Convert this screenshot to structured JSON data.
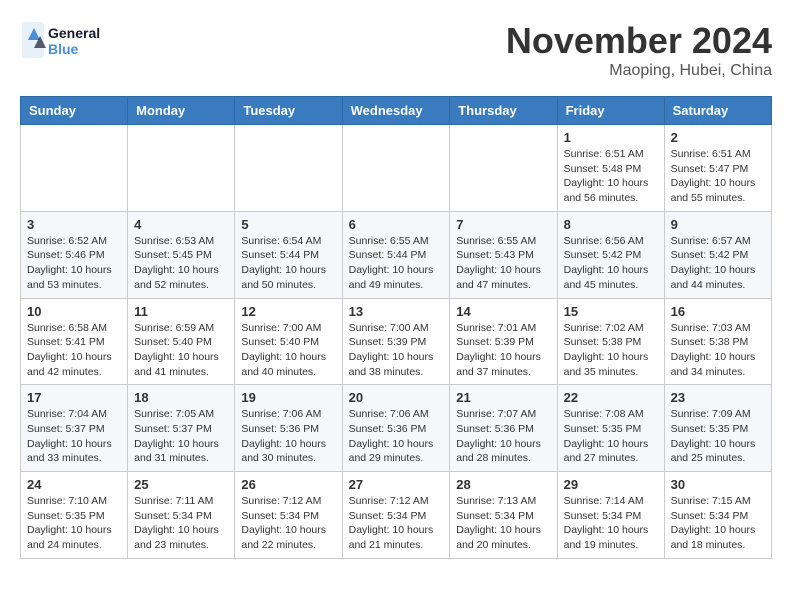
{
  "logo": {
    "line1": "General",
    "line2": "Blue"
  },
  "title": "November 2024",
  "location": "Maoping, Hubei, China",
  "days_of_week": [
    "Sunday",
    "Monday",
    "Tuesday",
    "Wednesday",
    "Thursday",
    "Friday",
    "Saturday"
  ],
  "weeks": [
    [
      null,
      null,
      null,
      null,
      null,
      {
        "day": "1",
        "sunrise": "Sunrise: 6:51 AM",
        "sunset": "Sunset: 5:48 PM",
        "daylight": "Daylight: 10 hours and 56 minutes."
      },
      {
        "day": "2",
        "sunrise": "Sunrise: 6:51 AM",
        "sunset": "Sunset: 5:47 PM",
        "daylight": "Daylight: 10 hours and 55 minutes."
      }
    ],
    [
      {
        "day": "3",
        "sunrise": "Sunrise: 6:52 AM",
        "sunset": "Sunset: 5:46 PM",
        "daylight": "Daylight: 10 hours and 53 minutes."
      },
      {
        "day": "4",
        "sunrise": "Sunrise: 6:53 AM",
        "sunset": "Sunset: 5:45 PM",
        "daylight": "Daylight: 10 hours and 52 minutes."
      },
      {
        "day": "5",
        "sunrise": "Sunrise: 6:54 AM",
        "sunset": "Sunset: 5:44 PM",
        "daylight": "Daylight: 10 hours and 50 minutes."
      },
      {
        "day": "6",
        "sunrise": "Sunrise: 6:55 AM",
        "sunset": "Sunset: 5:44 PM",
        "daylight": "Daylight: 10 hours and 49 minutes."
      },
      {
        "day": "7",
        "sunrise": "Sunrise: 6:55 AM",
        "sunset": "Sunset: 5:43 PM",
        "daylight": "Daylight: 10 hours and 47 minutes."
      },
      {
        "day": "8",
        "sunrise": "Sunrise: 6:56 AM",
        "sunset": "Sunset: 5:42 PM",
        "daylight": "Daylight: 10 hours and 45 minutes."
      },
      {
        "day": "9",
        "sunrise": "Sunrise: 6:57 AM",
        "sunset": "Sunset: 5:42 PM",
        "daylight": "Daylight: 10 hours and 44 minutes."
      }
    ],
    [
      {
        "day": "10",
        "sunrise": "Sunrise: 6:58 AM",
        "sunset": "Sunset: 5:41 PM",
        "daylight": "Daylight: 10 hours and 42 minutes."
      },
      {
        "day": "11",
        "sunrise": "Sunrise: 6:59 AM",
        "sunset": "Sunset: 5:40 PM",
        "daylight": "Daylight: 10 hours and 41 minutes."
      },
      {
        "day": "12",
        "sunrise": "Sunrise: 7:00 AM",
        "sunset": "Sunset: 5:40 PM",
        "daylight": "Daylight: 10 hours and 40 minutes."
      },
      {
        "day": "13",
        "sunrise": "Sunrise: 7:00 AM",
        "sunset": "Sunset: 5:39 PM",
        "daylight": "Daylight: 10 hours and 38 minutes."
      },
      {
        "day": "14",
        "sunrise": "Sunrise: 7:01 AM",
        "sunset": "Sunset: 5:39 PM",
        "daylight": "Daylight: 10 hours and 37 minutes."
      },
      {
        "day": "15",
        "sunrise": "Sunrise: 7:02 AM",
        "sunset": "Sunset: 5:38 PM",
        "daylight": "Daylight: 10 hours and 35 minutes."
      },
      {
        "day": "16",
        "sunrise": "Sunrise: 7:03 AM",
        "sunset": "Sunset: 5:38 PM",
        "daylight": "Daylight: 10 hours and 34 minutes."
      }
    ],
    [
      {
        "day": "17",
        "sunrise": "Sunrise: 7:04 AM",
        "sunset": "Sunset: 5:37 PM",
        "daylight": "Daylight: 10 hours and 33 minutes."
      },
      {
        "day": "18",
        "sunrise": "Sunrise: 7:05 AM",
        "sunset": "Sunset: 5:37 PM",
        "daylight": "Daylight: 10 hours and 31 minutes."
      },
      {
        "day": "19",
        "sunrise": "Sunrise: 7:06 AM",
        "sunset": "Sunset: 5:36 PM",
        "daylight": "Daylight: 10 hours and 30 minutes."
      },
      {
        "day": "20",
        "sunrise": "Sunrise: 7:06 AM",
        "sunset": "Sunset: 5:36 PM",
        "daylight": "Daylight: 10 hours and 29 minutes."
      },
      {
        "day": "21",
        "sunrise": "Sunrise: 7:07 AM",
        "sunset": "Sunset: 5:36 PM",
        "daylight": "Daylight: 10 hours and 28 minutes."
      },
      {
        "day": "22",
        "sunrise": "Sunrise: 7:08 AM",
        "sunset": "Sunset: 5:35 PM",
        "daylight": "Daylight: 10 hours and 27 minutes."
      },
      {
        "day": "23",
        "sunrise": "Sunrise: 7:09 AM",
        "sunset": "Sunset: 5:35 PM",
        "daylight": "Daylight: 10 hours and 25 minutes."
      }
    ],
    [
      {
        "day": "24",
        "sunrise": "Sunrise: 7:10 AM",
        "sunset": "Sunset: 5:35 PM",
        "daylight": "Daylight: 10 hours and 24 minutes."
      },
      {
        "day": "25",
        "sunrise": "Sunrise: 7:11 AM",
        "sunset": "Sunset: 5:34 PM",
        "daylight": "Daylight: 10 hours and 23 minutes."
      },
      {
        "day": "26",
        "sunrise": "Sunrise: 7:12 AM",
        "sunset": "Sunset: 5:34 PM",
        "daylight": "Daylight: 10 hours and 22 minutes."
      },
      {
        "day": "27",
        "sunrise": "Sunrise: 7:12 AM",
        "sunset": "Sunset: 5:34 PM",
        "daylight": "Daylight: 10 hours and 21 minutes."
      },
      {
        "day": "28",
        "sunrise": "Sunrise: 7:13 AM",
        "sunset": "Sunset: 5:34 PM",
        "daylight": "Daylight: 10 hours and 20 minutes."
      },
      {
        "day": "29",
        "sunrise": "Sunrise: 7:14 AM",
        "sunset": "Sunset: 5:34 PM",
        "daylight": "Daylight: 10 hours and 19 minutes."
      },
      {
        "day": "30",
        "sunrise": "Sunrise: 7:15 AM",
        "sunset": "Sunset: 5:34 PM",
        "daylight": "Daylight: 10 hours and 18 minutes."
      }
    ]
  ]
}
